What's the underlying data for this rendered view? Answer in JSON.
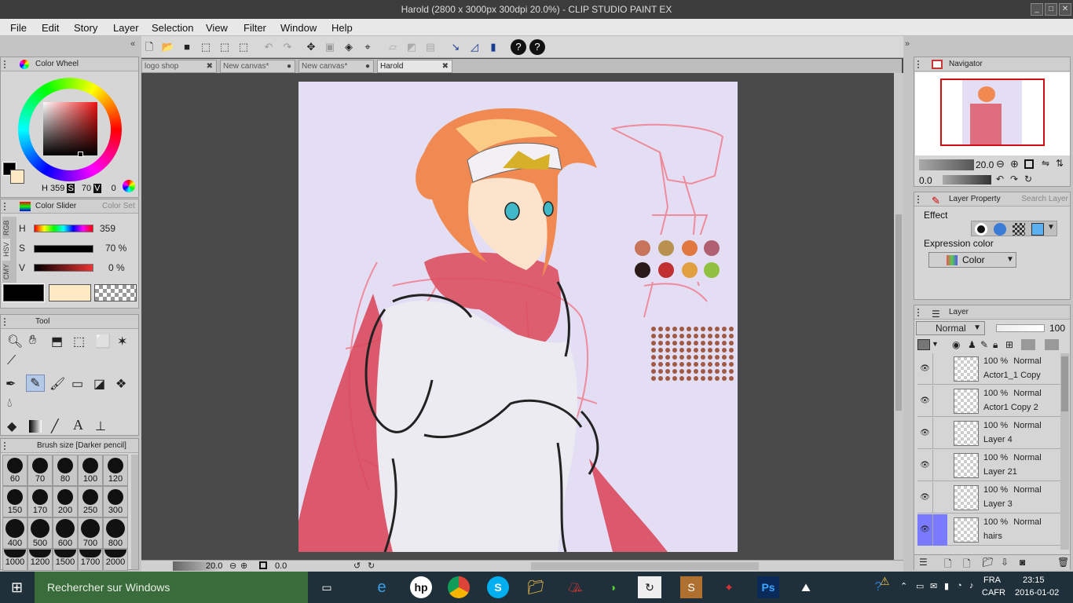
{
  "window": {
    "title": "Harold (2800 x 3000px 300dpi 20.0%) - CLIP STUDIO PAINT EX"
  },
  "menu": [
    "File",
    "Edit",
    "Story",
    "Layer",
    "Selection",
    "View",
    "Filter",
    "Window",
    "Help"
  ],
  "toolbar": {
    "help_label": "?",
    "icons": [
      "new-icon",
      "open-icon",
      "save-icon",
      "select-icon",
      "select-add-icon",
      "select-sub-icon",
      "undo-icon",
      "redo-icon",
      "transform-icon",
      "clear-icon",
      "fill-icon",
      "fit-icon",
      "ruler-icon",
      "ruler-snap-icon",
      "perspective-icon",
      "pen-icon",
      "pen-angle-icon",
      "pen-pressure-icon",
      "help-icon",
      "help-context-icon"
    ]
  },
  "colors": {
    "main_color": "#000000",
    "sub_color": "#fde9c4",
    "paper": "#e3def3"
  },
  "color_wheel": {
    "tab_label": "Color Wheel",
    "h_label": "H",
    "h_value": "359",
    "s_label": "S",
    "s_value": "70",
    "v_label": "V",
    "v_value": "0"
  },
  "color_slider": {
    "tab_label": "Color Slider",
    "tab2_label": "Color Set",
    "side_tabs": [
      "RGB",
      "HSV",
      "CMY"
    ],
    "h": {
      "label": "H",
      "value": "359"
    },
    "s": {
      "label": "S",
      "value": "70 %"
    },
    "v": {
      "label": "V",
      "value": "0 %"
    }
  },
  "tool": {
    "tab_label": "Tool"
  },
  "brush_size": {
    "tab_label": "Brush size [Darker pencil]",
    "sizes": [
      "60",
      "70",
      "80",
      "100",
      "120",
      "150",
      "170",
      "200",
      "250",
      "300",
      "400",
      "500",
      "600",
      "700",
      "800",
      "1000",
      "1200",
      "1500",
      "1700",
      "2000"
    ]
  },
  "doc_tabs": [
    {
      "label": "logo shop"
    },
    {
      "label": "New canvas*"
    },
    {
      "label": "New canvas*"
    },
    {
      "label": "Harold",
      "active": true
    }
  ],
  "status": {
    "zoom": "20.0",
    "angle": "0.0"
  },
  "navigator": {
    "tab_label": "Navigator",
    "zoom": "20.0",
    "angle": "0.0"
  },
  "layer_property": {
    "tab_label": "Layer Property",
    "tab2_label": "Search Layer",
    "effect_label": "Effect",
    "expression_label": "Expression color",
    "expression_value": "Color"
  },
  "layer_panel": {
    "tab_label": "Layer",
    "blend_mode": "Normal",
    "opacity": "100",
    "layers": [
      {
        "opacity": "100 %",
        "mode": "Normal",
        "name": "Actor1_1 Copy",
        "selected": false
      },
      {
        "opacity": "100 %",
        "mode": "Normal",
        "name": "Actor1 Copy 2",
        "selected": false
      },
      {
        "opacity": "100 %",
        "mode": "Normal",
        "name": "Layer 4",
        "selected": false
      },
      {
        "opacity": "100 %",
        "mode": "Normal",
        "name": "Layer 21",
        "selected": false
      },
      {
        "opacity": "100 %",
        "mode": "Normal",
        "name": "Layer 3",
        "selected": false
      },
      {
        "opacity": "100 %",
        "mode": "Normal",
        "name": "hairs",
        "selected": true
      }
    ]
  },
  "taskbar": {
    "search_placeholder": "Rechercher sur Windows",
    "lang1": "FRA",
    "lang2": "CAFR",
    "time": "23:15",
    "date": "2016-01-02"
  }
}
